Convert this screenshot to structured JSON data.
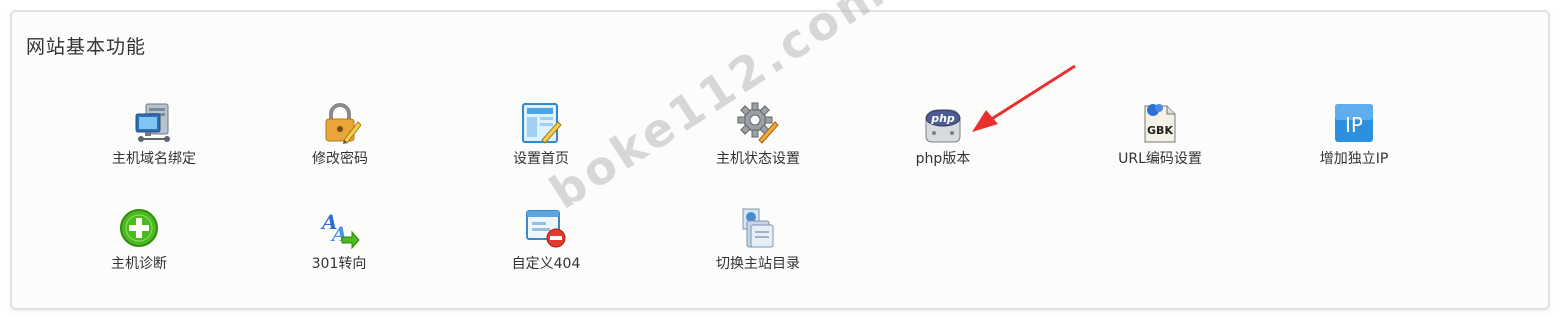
{
  "panel": {
    "title": "网站基本功能"
  },
  "items": [
    {
      "label": "主机域名绑定",
      "icon": "network-computer-icon"
    },
    {
      "label": "修改密码",
      "icon": "lock-pencil-icon"
    },
    {
      "label": "设置首页",
      "icon": "page-edit-icon"
    },
    {
      "label": "主机状态设置",
      "icon": "gear-pencil-icon"
    },
    {
      "label": "php版本",
      "icon": "php-icon"
    },
    {
      "label": "URL编码设置",
      "icon": "gbk-file-icon"
    },
    {
      "label": "增加独立IP",
      "icon": "ip-icon"
    },
    {
      "label": "主机诊断",
      "icon": "plus-circle-icon"
    },
    {
      "label": "301转向",
      "icon": "font-arrow-icon"
    },
    {
      "label": "自定义404",
      "icon": "window-remove-icon"
    },
    {
      "label": "切换主站目录",
      "icon": "folder-switch-icon"
    }
  ],
  "watermark": "boke112.com",
  "colors": {
    "arrow": "#e8302f",
    "border": "#e2e2e2",
    "ip_blue": "#2d8fe0",
    "plus_green": "#4cba1f"
  }
}
